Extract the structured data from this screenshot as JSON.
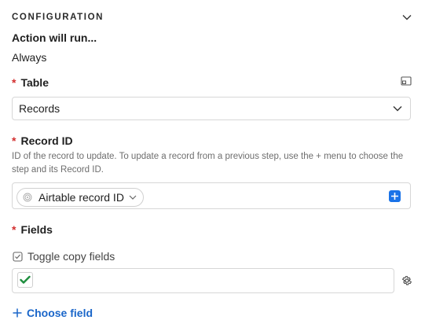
{
  "section": {
    "title": "CONFIGURATION"
  },
  "action": {
    "heading": "Action will run...",
    "value": "Always"
  },
  "table": {
    "required_mark": "*",
    "label": "Table",
    "selected": "Records"
  },
  "record_id": {
    "required_mark": "*",
    "label": "Record ID",
    "description": "ID of the record to update. To update a record from a previous step, use the + menu to choose the step and its Record ID.",
    "token_label": "Airtable record ID"
  },
  "fields": {
    "required_mark": "*",
    "label": "Fields",
    "toggle_label": "Toggle copy fields",
    "checkbox_checked": true,
    "choose_field_label": "Choose field"
  },
  "colors": {
    "accent": "#1a73e8",
    "link": "#1a66c9",
    "required": "#d32f2f",
    "check": "#1e8e3e"
  },
  "icons": {
    "collapse": "chevron-down-icon",
    "table_expand": "expand-window-icon",
    "select_chevron": "chevron-down-icon",
    "token": "fingerprint-icon",
    "add": "plus-icon",
    "toggle": "checkbox-icon",
    "check": "checkmark-icon",
    "settings": "gear-icon"
  }
}
